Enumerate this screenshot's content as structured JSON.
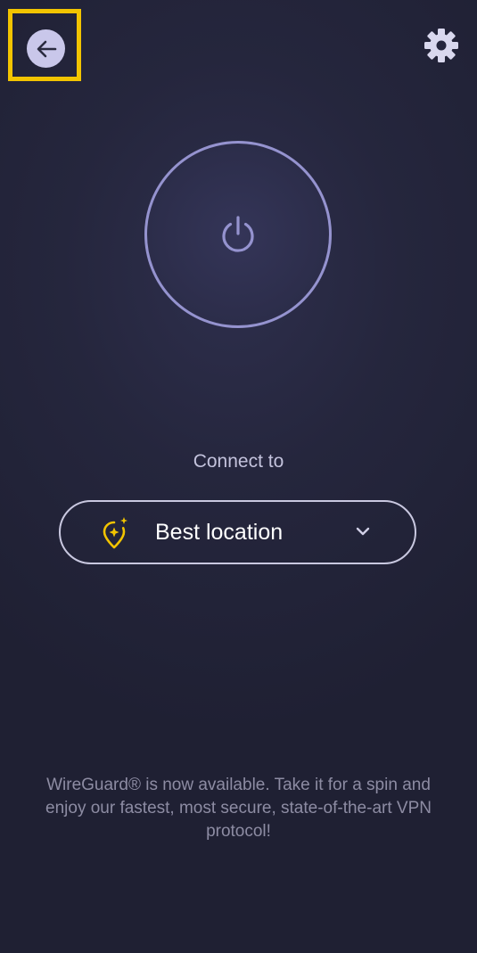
{
  "app": {
    "connect_label": "Connect to",
    "location": {
      "selected": "Best location",
      "icon": "location-pin-sparkle-icon"
    },
    "promo_text": "WireGuard® is now available. Take it for a spin and enjoy our fastest, most secure, state-of-the-art VPN protocol!"
  },
  "icons": {
    "back": "arrow-left-icon",
    "settings": "gear-icon",
    "power": "power-icon",
    "chevron": "chevron-down-icon"
  },
  "colors": {
    "background": "#25263d",
    "power_ring": "#9593cf",
    "accent_yellow": "#f2c400",
    "text_primary": "#ffffff",
    "text_secondary": "#c3c2dc",
    "text_muted": "#8d8ca3"
  }
}
